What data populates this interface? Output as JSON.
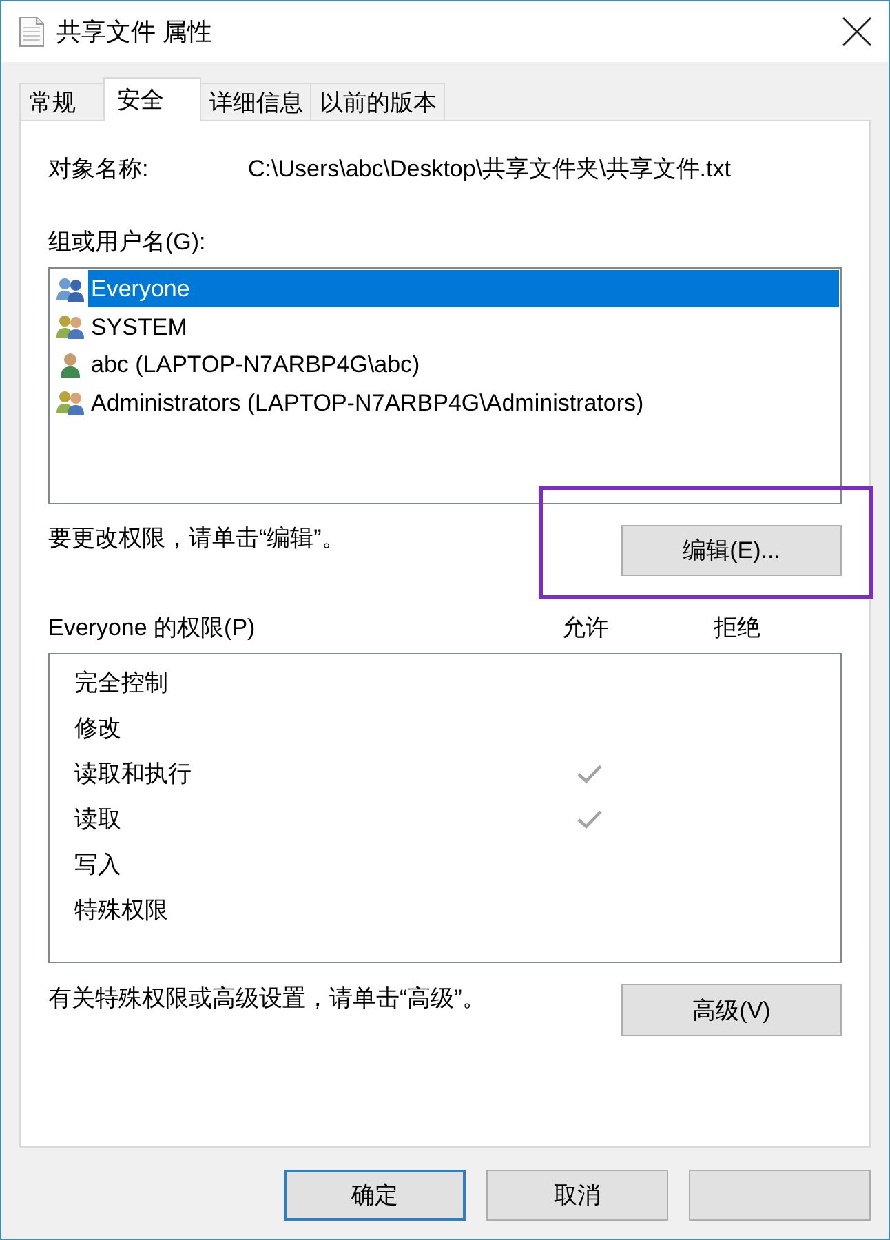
{
  "window": {
    "title": "共享文件 属性"
  },
  "tabs": [
    {
      "label": "常规",
      "selected": false
    },
    {
      "label": "安全",
      "selected": true
    },
    {
      "label": "详细信息",
      "selected": false
    },
    {
      "label": "以前的版本",
      "selected": false
    }
  ],
  "object": {
    "label": "对象名称:",
    "value": "C:\\Users\\abc\\Desktop\\共享文件夹\\共享文件.txt"
  },
  "groups": {
    "label": "组或用户名(G):",
    "items": [
      {
        "name": "Everyone",
        "kind": "everyone",
        "selected": true
      },
      {
        "name": "SYSTEM",
        "kind": "group",
        "selected": false
      },
      {
        "name": "abc (LAPTOP-N7ARBP4G\\abc)",
        "kind": "user",
        "selected": false
      },
      {
        "name": "Administrators (LAPTOP-N7ARBP4G\\Administrators)",
        "kind": "group",
        "selected": false
      }
    ]
  },
  "edit": {
    "hint": "要更改权限，请单击“编辑”。",
    "button": "编辑(E)...",
    "highlighted": true
  },
  "permissions": {
    "title": "Everyone 的权限(P)",
    "allow_heading": "允许",
    "deny_heading": "拒绝",
    "rows": [
      {
        "name": "完全控制",
        "allow": false,
        "deny": false
      },
      {
        "name": "修改",
        "allow": false,
        "deny": false
      },
      {
        "name": "读取和执行",
        "allow": true,
        "deny": false
      },
      {
        "name": "读取",
        "allow": true,
        "deny": false
      },
      {
        "name": "写入",
        "allow": false,
        "deny": false
      },
      {
        "name": "特殊权限",
        "allow": false,
        "deny": false
      }
    ]
  },
  "advanced": {
    "hint": "有关特殊权限或高级设置，请单击“高级”。",
    "button": "高级(V)"
  },
  "buttons": [
    {
      "label": "确定",
      "kind": "default"
    },
    {
      "label": "取消",
      "kind": "normal"
    },
    {
      "kind": "blank"
    }
  ]
}
